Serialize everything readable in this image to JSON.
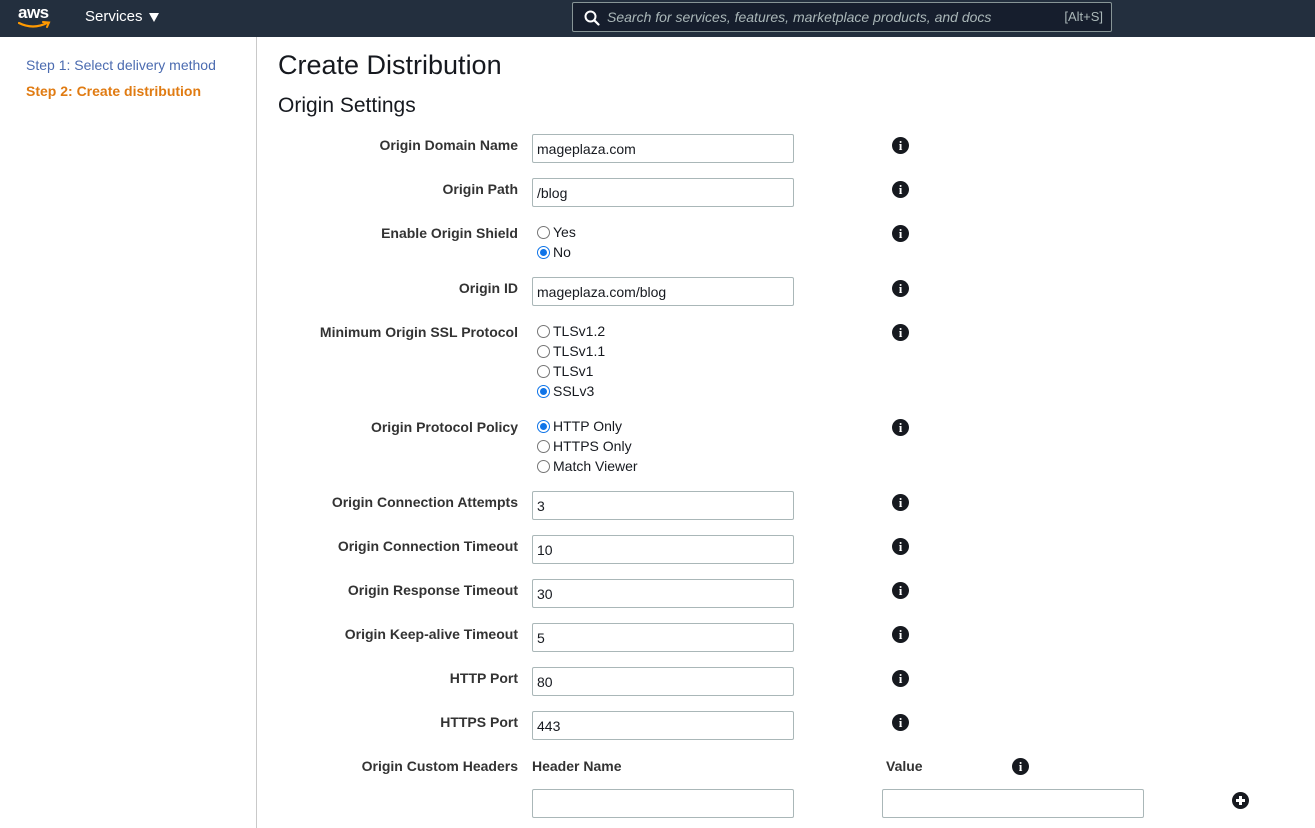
{
  "topnav": {
    "logo_text": "aws",
    "services_label": "Services",
    "search_placeholder": "Search for services, features, marketplace products, and docs",
    "search_shortcut": "[Alt+S]"
  },
  "sidebar": {
    "steps": [
      {
        "label": "Step 1: Select delivery method",
        "active": false
      },
      {
        "label": "Step 2: Create distribution",
        "active": true
      }
    ]
  },
  "main": {
    "title": "Create Distribution",
    "section_title": "Origin Settings",
    "info_glyph": "i",
    "fields": {
      "origin_domain_name": {
        "label": "Origin Domain Name",
        "value": "mageplaza.com"
      },
      "origin_path": {
        "label": "Origin Path",
        "value": "/blog"
      },
      "enable_origin_shield": {
        "label": "Enable Origin Shield",
        "options": [
          "Yes",
          "No"
        ],
        "selected": "No"
      },
      "origin_id": {
        "label": "Origin ID",
        "value": "mageplaza.com/blog"
      },
      "min_ssl_protocol": {
        "label": "Minimum Origin SSL Protocol",
        "options": [
          "TLSv1.2",
          "TLSv1.1",
          "TLSv1",
          "SSLv3"
        ],
        "selected": "SSLv3"
      },
      "origin_protocol_policy": {
        "label": "Origin Protocol Policy",
        "options": [
          "HTTP Only",
          "HTTPS Only",
          "Match Viewer"
        ],
        "selected": "HTTP Only"
      },
      "connection_attempts": {
        "label": "Origin Connection Attempts",
        "value": "3"
      },
      "connection_timeout": {
        "label": "Origin Connection Timeout",
        "value": "10"
      },
      "response_timeout": {
        "label": "Origin Response Timeout",
        "value": "30"
      },
      "keepalive_timeout": {
        "label": "Origin Keep-alive Timeout",
        "value": "5"
      },
      "http_port": {
        "label": "HTTP Port",
        "value": "80"
      },
      "https_port": {
        "label": "HTTPS Port",
        "value": "443"
      },
      "custom_headers": {
        "label": "Origin Custom Headers",
        "header_name_label": "Header Name",
        "value_label": "Value",
        "header_name": "",
        "header_value": ""
      }
    }
  },
  "colors": {
    "nav_bg": "#232f3e",
    "step_link": "#4b6bb0",
    "step_active": "#e07b12",
    "radio_accent": "#0f74e8"
  }
}
